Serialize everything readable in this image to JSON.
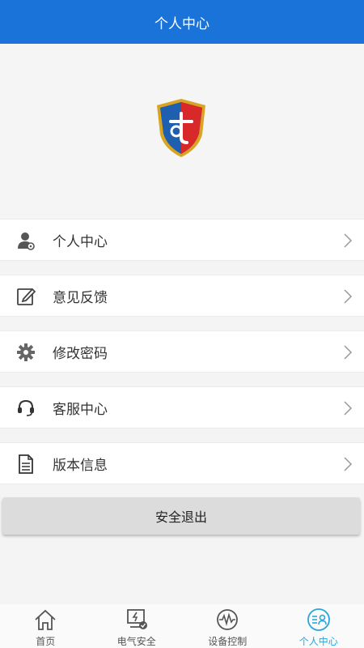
{
  "header": {
    "title": "个人中心"
  },
  "menu": [
    {
      "label": "个人中心",
      "icon": "user-icon"
    },
    {
      "label": "意见反馈",
      "icon": "edit-icon"
    },
    {
      "label": "修改密码",
      "icon": "gear-icon"
    },
    {
      "label": "客服中心",
      "icon": "headset-icon"
    },
    {
      "label": "版本信息",
      "icon": "document-icon"
    }
  ],
  "logout_label": "安全退出",
  "tabs": [
    {
      "label": "首页",
      "icon": "home-icon"
    },
    {
      "label": "电气安全",
      "icon": "electric-safety-icon"
    },
    {
      "label": "设备控制",
      "icon": "device-control-icon"
    },
    {
      "label": "个人中心",
      "icon": "profile-icon",
      "active": true
    }
  ],
  "colors": {
    "header_bg": "#1a73d9",
    "active_tab": "#2aa7d9",
    "logo_red": "#d8282a",
    "logo_blue": "#1f5fb0",
    "logo_gold": "#d9a420"
  }
}
